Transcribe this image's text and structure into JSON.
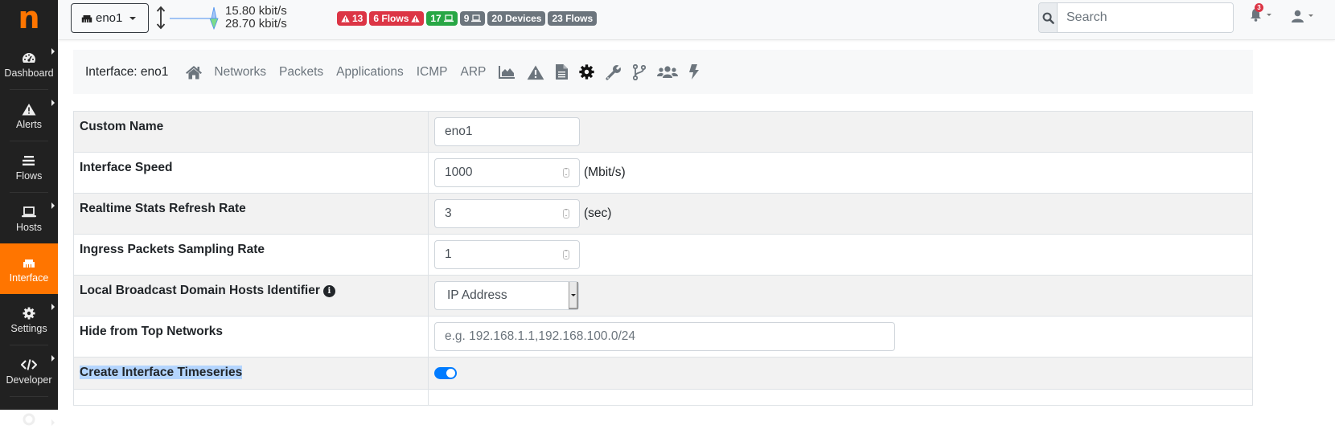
{
  "app": {
    "logo_letter": "n"
  },
  "sidebar": {
    "items": [
      {
        "label": "Dashboard",
        "icon": "gauge-icon",
        "has_submenu": true
      },
      {
        "label": "Alerts",
        "icon": "warning-icon",
        "has_submenu": true
      },
      {
        "label": "Flows",
        "icon": "bars-icon",
        "has_submenu": false
      },
      {
        "label": "Hosts",
        "icon": "laptop-icon",
        "has_submenu": true
      },
      {
        "label": "Interface",
        "icon": "ethernet-icon",
        "has_submenu": false,
        "active": true
      },
      {
        "label": "Settings",
        "icon": "gear-icon",
        "has_submenu": true
      },
      {
        "label": "Developer",
        "icon": "code-icon",
        "has_submenu": true
      }
    ],
    "active_color": "#ff7500"
  },
  "topbar": {
    "interface_selector": "eno1",
    "upload_rate": "15.80 kbit/s",
    "download_rate": "28.70 kbit/s",
    "badges": [
      {
        "text": "13",
        "icon": "warning-icon",
        "icon_pos": "before",
        "color": "#dc3545"
      },
      {
        "text": "6 Flows",
        "icon": "warning-icon",
        "icon_pos": "after",
        "color": "#dc3545"
      },
      {
        "text": "17",
        "icon": "laptop-icon",
        "icon_pos": "after",
        "color": "#28a745"
      },
      {
        "text": "9",
        "icon": "laptop-icon",
        "icon_pos": "after",
        "color": "#6c757d"
      },
      {
        "text": "20 Devices",
        "color": "#6c757d"
      },
      {
        "text": "23 Flows",
        "color": "#6c757d"
      }
    ],
    "search_placeholder": "Search",
    "notifications_count": "3"
  },
  "subnav": {
    "title": "Interface: eno1",
    "links": [
      "Networks",
      "Packets",
      "Applications",
      "ICMP",
      "ARP"
    ],
    "icons": [
      "home-icon",
      "area-chart-icon",
      "warning-icon",
      "file-icon",
      "gear-icon",
      "wrench-icon",
      "code-branch-icon",
      "users-icon",
      "bolt-icon"
    ],
    "active_icon": "gear-icon"
  },
  "settings": {
    "custom_name": {
      "label": "Custom Name",
      "value": "eno1"
    },
    "interface_speed": {
      "label": "Interface Speed",
      "value": "1000",
      "unit": "(Mbit/s)"
    },
    "refresh_rate": {
      "label": "Realtime Stats Refresh Rate",
      "value": "3",
      "unit": "(sec)"
    },
    "sampling_rate": {
      "label": "Ingress Packets Sampling Rate",
      "value": "1"
    },
    "broadcast_identifier": {
      "label": "Local Broadcast Domain Hosts Identifier",
      "info_icon": "info-icon",
      "selected": "IP Address"
    },
    "hide_networks": {
      "label": "Hide from Top Networks",
      "value": "",
      "placeholder": "e.g. 192.168.1.1,192.168.100.0/24"
    },
    "timeseries": {
      "label": "Create Interface Timeseries",
      "enabled": true
    }
  }
}
